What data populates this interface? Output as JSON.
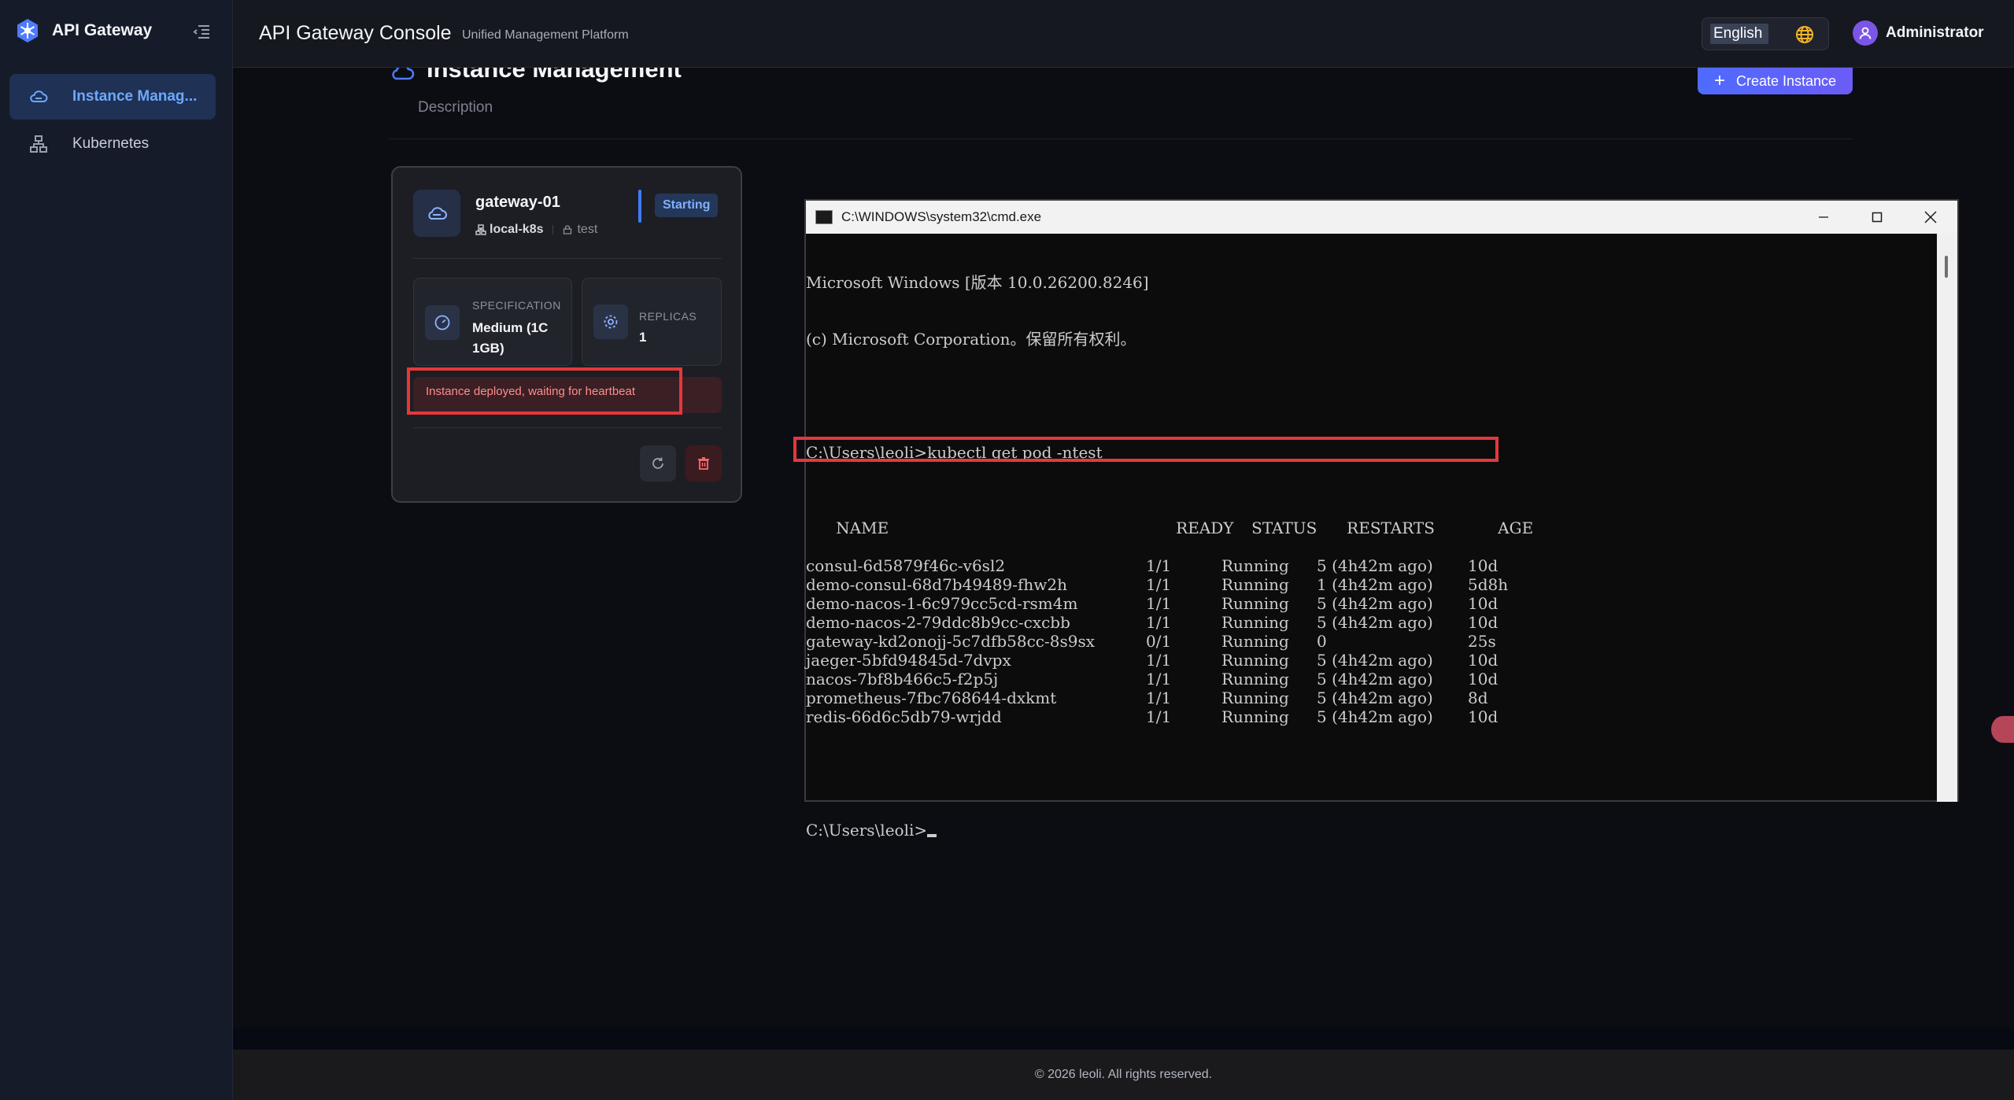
{
  "sidebar": {
    "brand": "API Gateway",
    "items": [
      {
        "label": "Instance Manag...",
        "icon": "cloud-icon",
        "active": true
      },
      {
        "label": "Kubernetes",
        "icon": "cluster-icon",
        "active": false
      }
    ]
  },
  "header": {
    "title": "API Gateway Console",
    "subtitle": "Unified Management Platform",
    "language": "English",
    "user": "Administrator"
  },
  "page": {
    "title": "Instance Management",
    "description": "Description",
    "create_label": "Create Instance"
  },
  "instance": {
    "name": "gateway-01",
    "cluster": "local-k8s",
    "namespace": "test",
    "status": "Starting",
    "spec_label": "SPECIFICATION",
    "spec_value": "Medium (1C 1GB)",
    "replicas_label": "REPLICAS",
    "replicas_value": "1",
    "message": "Instance deployed, waiting for heartbeat"
  },
  "cmd": {
    "title": "C:\\WINDOWS\\system32\\cmd.exe",
    "banner1": "Microsoft Windows [版本 10.0.26200.8246]",
    "banner2": "(c) Microsoft Corporation。保留所有权利。",
    "command": "C:\\Users\\leoli>kubectl get pod -ntest",
    "headers": [
      "NAME",
      "READY",
      "STATUS",
      "RESTARTS",
      "AGE"
    ],
    "rows": [
      [
        "consul-6d5879f46c-v6sl2",
        "1/1",
        "Running",
        "5 (4h42m ago)",
        "10d"
      ],
      [
        "demo-consul-68d7b49489-fhw2h",
        "1/1",
        "Running",
        "1 (4h42m ago)",
        "5d8h"
      ],
      [
        "demo-nacos-1-6c979cc5cd-rsm4m",
        "1/1",
        "Running",
        "5 (4h42m ago)",
        "10d"
      ],
      [
        "demo-nacos-2-79ddc8b9cc-cxcbb",
        "1/1",
        "Running",
        "5 (4h42m ago)",
        "10d"
      ],
      [
        "gateway-kd2onojj-5c7dfb58cc-8s9sx",
        "0/1",
        "Running",
        "0",
        "25s"
      ],
      [
        "jaeger-5bfd94845d-7dvpx",
        "1/1",
        "Running",
        "5 (4h42m ago)",
        "10d"
      ],
      [
        "nacos-7bf8b466c5-f2p5j",
        "1/1",
        "Running",
        "5 (4h42m ago)",
        "10d"
      ],
      [
        "prometheus-7fbc768644-dxkmt",
        "1/1",
        "Running",
        "5 (4h42m ago)",
        "8d"
      ],
      [
        "redis-66d6c5db79-wrjdd",
        "1/1",
        "Running",
        "5 (4h42m ago)",
        "10d"
      ]
    ],
    "prompt": "C:\\Users\\leoli>"
  },
  "footer": {
    "copyright": "© 2026 leoli. All rights reserved."
  },
  "colors": {
    "accent": "#3d7bff",
    "danger": "#e5383b"
  }
}
